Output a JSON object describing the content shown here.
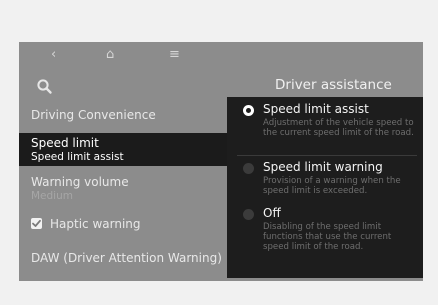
{
  "nav": {
    "back_icon": "‹",
    "home_icon": "⌂",
    "menu_icon": "≡"
  },
  "header": {
    "title": "Driver assistance"
  },
  "menu": {
    "section_heading": "Driving Convenience",
    "speed_limit_label": "Speed limit",
    "speed_limit_value": "Speed limit assist",
    "warning_volume_label": "Warning volume",
    "warning_volume_value": "Medium",
    "haptic_warning_label": "Haptic warning",
    "haptic_warning_checked": true,
    "daw_label": "DAW (Driver Attention Warning)"
  },
  "speed_limit_options": [
    {
      "label": "Speed limit assist",
      "description": "Adjustment of the vehicle speed to the current speed limit of the road.",
      "selected": true
    },
    {
      "label": "Speed limit warning",
      "description": "Provision of a warning when the speed limit is exceeded.",
      "selected": false
    },
    {
      "label": "Off",
      "description": "Disabling of the speed limit functions that use the current speed limit of the road.",
      "selected": false
    }
  ],
  "colors": {
    "screen_background": "#8c8c8c",
    "popup_background": "#1d1d1d",
    "selected_row": "#1b1b1b"
  }
}
